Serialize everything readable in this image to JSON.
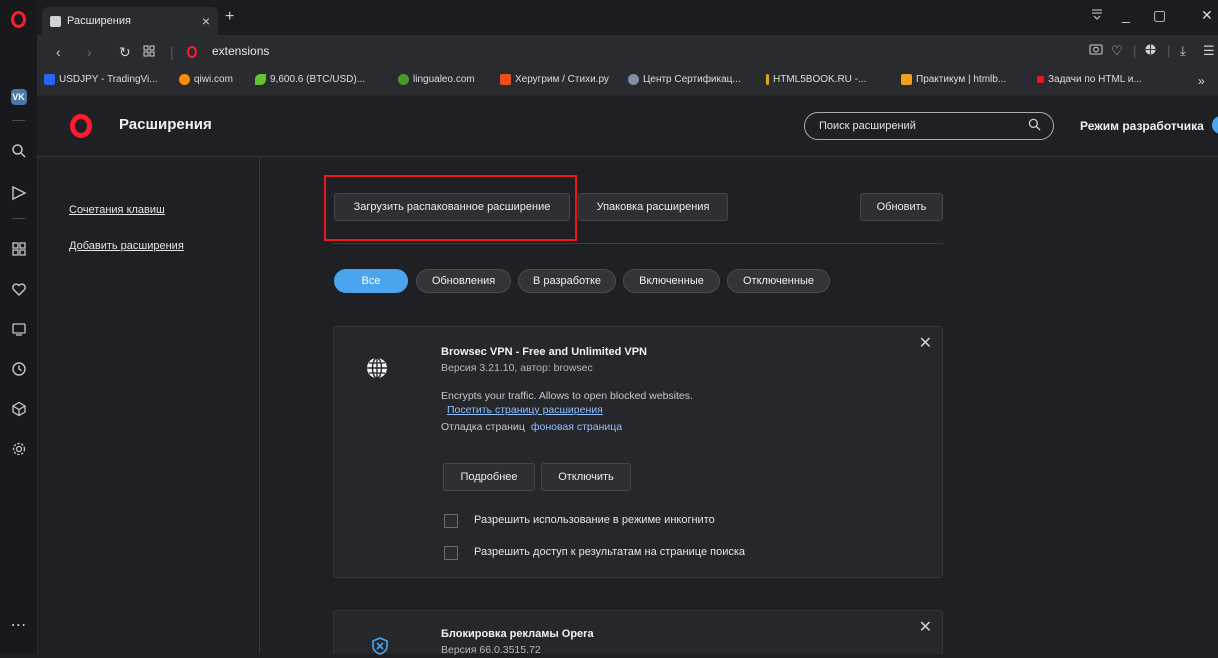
{
  "browser": {
    "tab_title": "Расширения",
    "tab_close": "×",
    "new_tab": "+",
    "url": "extensions",
    "window_controls": [
      "_",
      "▢",
      "✕"
    ]
  },
  "bookmarks": [
    {
      "label": "USDJPY - TradingVi...",
      "icon": "tradingview-icon",
      "color": "#2962ff"
    },
    {
      "label": "qiwi.com",
      "icon": "qiwi-icon",
      "color": "#ff8c00"
    },
    {
      "label": "9,600.6 (BTC/USD)...",
      "icon": "leaf-icon",
      "color": "#63c132"
    },
    {
      "label": "lingualeo.com",
      "icon": "lingualeo-icon",
      "color": "#4c9a2a"
    },
    {
      "label": "Херугрим / Стихи.ру",
      "icon": "stihi-icon",
      "color": "#e8521a"
    },
    {
      "label": "Центр Сертификац...",
      "icon": "cert-icon",
      "color": "#7f8fa6"
    },
    {
      "label": "HTML5BOOK.RU -...",
      "icon": "html5book-icon",
      "color": "#d9a520"
    },
    {
      "label": "Практикум | htmlb...",
      "icon": "practicum-icon",
      "color": "#f0a020"
    },
    {
      "label": "Задачи по HTML и...",
      "icon": "tasks-icon",
      "color": "#e8182a"
    }
  ],
  "bookmarks_more": "»",
  "header": {
    "title": "Расширения",
    "search_placeholder": "Поиск расширений",
    "dev_mode_label": "Режим разработчика",
    "dev_mode_on": true
  },
  "sidenav": {
    "items": [
      "Сочетания клавиш",
      "Добавить расширения"
    ]
  },
  "toolbar": {
    "load_unpacked": "Загрузить распакованное расширение",
    "pack": "Упаковка расширения",
    "update": "Обновить"
  },
  "filters": [
    "Все",
    "Обновления",
    "В разработке",
    "Включенные",
    "Отключенные"
  ],
  "extensions": [
    {
      "name": "Browsec VPN - Free and Unlimited VPN",
      "version": "Версия 3.21.10, автор: browsec",
      "description": "Encrypts your traffic. Allows to open blocked websites.",
      "link": "Посетить страницу расширения",
      "debug_label": "Отладка страниц",
      "debug_link": "фоновая страница",
      "details_button": "Подробнее",
      "disable_button": "Отключить",
      "options": [
        "Разрешить использование в режиме инкогнито",
        "Разрешить доступ к результатам на странице поиска"
      ]
    },
    {
      "name": "Блокировка рекламы Opera",
      "version": "Версия 66.0.3515.72"
    }
  ],
  "colors": {
    "accent": "#4aa5ee",
    "highlight_box": "#e8181e",
    "opera_red": "#ff1b2d"
  }
}
